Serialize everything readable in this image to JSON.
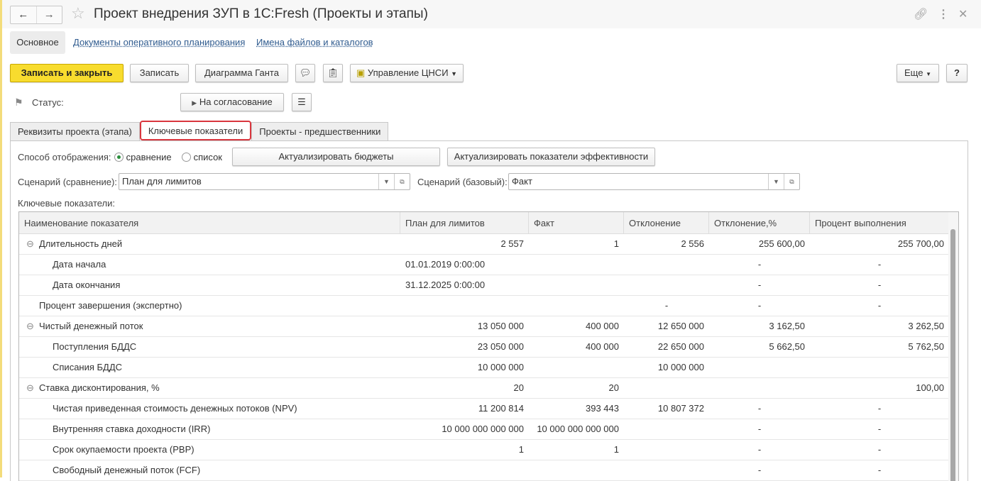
{
  "window": {
    "title": "Проект внедрения ЗУП в 1С:Fresh (Проекты и этапы)"
  },
  "sections": {
    "main": "Основное",
    "docs": "Документы оперативного планирования",
    "files": "Имена файлов и каталогов"
  },
  "toolbar": {
    "save_close": "Записать и закрыть",
    "save": "Записать",
    "gantt": "Диаграмма Ганта",
    "cnsi": "Управление ЦНСИ",
    "more": "Еще",
    "help": "?"
  },
  "status": {
    "label": "Статус:",
    "button": "На согласование"
  },
  "tabs": [
    "Реквизиты проекта (этапа)",
    "Ключевые показатели",
    "Проекты - предшественники"
  ],
  "display": {
    "label": "Способ отображения:",
    "opt_compare": "сравнение",
    "opt_list": "список",
    "selected": "сравнение",
    "btn_budgets": "Актуализировать бюджеты",
    "btn_kpi": "Актуализировать показатели эффективности"
  },
  "scenario": {
    "compare_label": "Сценарий (сравнение):",
    "compare_value": "План для лимитов",
    "base_label": "Сценарий (базовый):",
    "base_value": "Факт"
  },
  "grid": {
    "title": "Ключевые показатели:",
    "columns": [
      "Наименование показателя",
      "План для лимитов",
      "Факт",
      "Отклонение",
      "Отклонение,%",
      "Процент выполнения"
    ],
    "rows": [
      {
        "name": "Длительность дней",
        "level": 0,
        "group": true,
        "plan": "2 557",
        "fact": "1",
        "dev": "2 556",
        "devp": "255 600,00",
        "pct": "255 700,00"
      },
      {
        "name": "Дата начала",
        "level": 1,
        "plan": "01.01.2019 0:00:00",
        "fact": "",
        "dev": "",
        "devp": "-",
        "pct": "-"
      },
      {
        "name": "Дата окончания",
        "level": 1,
        "plan": "31.12.2025 0:00:00",
        "fact": "",
        "dev": "",
        "devp": "-",
        "pct": "-"
      },
      {
        "name": "Процент завершения (экспертно)",
        "level": 0,
        "plan": "",
        "fact": "",
        "dev": "-",
        "devp": "-",
        "pct": "-"
      },
      {
        "name": "Чистый денежный поток",
        "level": 0,
        "group": true,
        "plan": "13 050 000",
        "fact": "400 000",
        "dev": "12 650 000",
        "devp": "3 162,50",
        "pct": "3 262,50"
      },
      {
        "name": "Поступления БДДС",
        "level": 1,
        "plan": "23 050 000",
        "fact": "400 000",
        "dev": "22 650 000",
        "devp": "5 662,50",
        "pct": "5 762,50"
      },
      {
        "name": "Списания БДДС",
        "level": 1,
        "plan": "10 000 000",
        "fact": "",
        "dev": "10 000 000",
        "devp": "",
        "pct": ""
      },
      {
        "name": "Ставка дисконтирования, %",
        "level": 0,
        "group": true,
        "plan": "20",
        "fact": "20",
        "dev": "",
        "devp": "",
        "pct": "100,00"
      },
      {
        "name": "Чистая приведенная стоимость денежных потоков (NPV)",
        "level": 1,
        "plan": "11 200 814",
        "fact": "393 443",
        "dev": "10 807 372",
        "devp": "-",
        "pct": "-"
      },
      {
        "name": "Внутренняя ставка доходности (IRR)",
        "level": 1,
        "plan": "10 000 000 000 000",
        "fact": "10 000 000 000 000",
        "dev": "",
        "devp": "-",
        "pct": "-"
      },
      {
        "name": "Срок окупаемости проекта (PBP)",
        "level": 1,
        "plan": "1",
        "fact": "1",
        "dev": "",
        "devp": "-",
        "pct": "-"
      },
      {
        "name": "Свободный денежный поток (FCF)",
        "level": 1,
        "plan": "",
        "fact": "",
        "dev": "",
        "devp": "-",
        "pct": "-"
      }
    ]
  }
}
